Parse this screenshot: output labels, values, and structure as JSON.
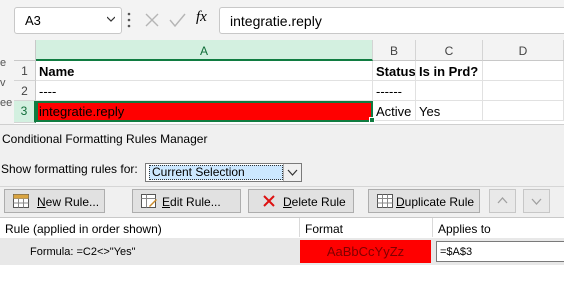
{
  "formula_bar": {
    "name_box": "A3",
    "fx_label": "fx",
    "formula": "integratie.reply"
  },
  "left_strip": {
    "rows": [
      "e",
      "v",
      "ee"
    ]
  },
  "sheet": {
    "columns": [
      "A",
      "B",
      "C",
      "D"
    ],
    "rows": [
      {
        "num": "1",
        "cells": [
          "Name",
          "Status",
          "Is in Prd?",
          ""
        ]
      },
      {
        "num": "2",
        "cells": [
          "----",
          "------",
          "",
          ""
        ]
      },
      {
        "num": "3",
        "cells": [
          "integratie.reply",
          "Active",
          "Yes",
          ""
        ]
      }
    ],
    "selected_fill": "#ff0000"
  },
  "dialog": {
    "title": "Conditional Formatting Rules Manager",
    "show_label": "Show formatting rules for:",
    "show_value": "Current Selection",
    "buttons": {
      "new_rule": "New Rule...",
      "edit_rule": "Edit Rule...",
      "delete_rule": "Delete Rule",
      "duplicate_rule": "Duplicate Rule"
    },
    "list_headers": {
      "rule": "Rule (applied in order shown)",
      "format": "Format",
      "applies_to": "Applies to"
    },
    "rules": [
      {
        "rule": "Formula: =C2<>\"Yes\"",
        "format_preview": "AaBbCcYyZz",
        "applies_to": "=$A$3",
        "format_fill": "#ff0000"
      }
    ]
  }
}
